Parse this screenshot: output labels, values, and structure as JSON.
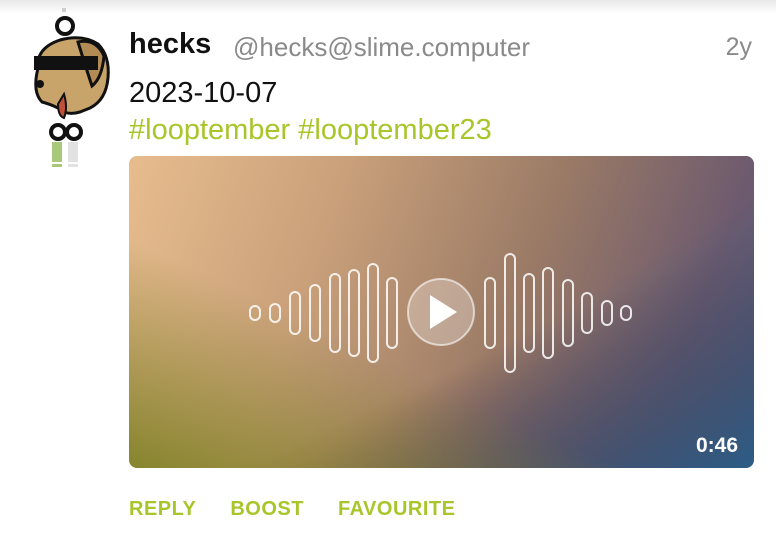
{
  "post": {
    "author_name": "hecks",
    "handle": "@hecks@slime.computer",
    "relative_time": "2y",
    "content": "2023-10-07",
    "tags": [
      "#looptember",
      "#looptember23"
    ],
    "avatar_icon": "dog-avatar-icon"
  },
  "media": {
    "type": "audio",
    "duration": "0:46",
    "play_icon": "play-icon",
    "waveform_icon": "waveform-icon"
  },
  "actions": {
    "reply": "REPLY",
    "boost": "BOOST",
    "favourite": "FAVOURITE"
  },
  "colors": {
    "accent": "#a8c52a",
    "muted_text": "#8a8a8a",
    "text": "#111111"
  }
}
